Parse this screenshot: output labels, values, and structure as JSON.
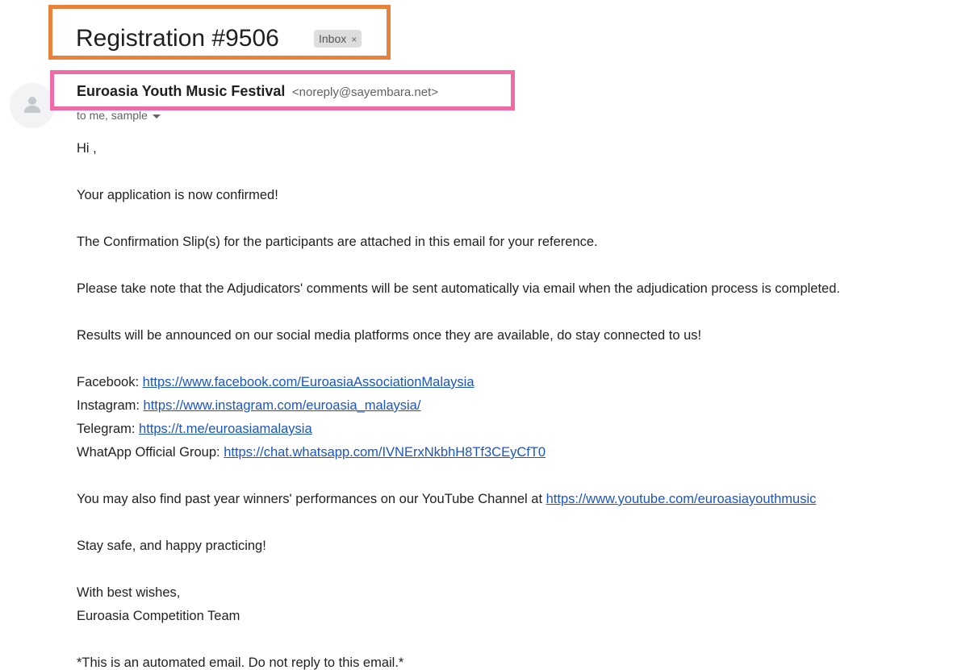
{
  "subject": {
    "title": "Registration #9506",
    "label": "Inbox",
    "label_close": "×"
  },
  "sender": {
    "name": "Euroasia Youth Music Festival",
    "email": "<noreply@sayembara.net>",
    "recipients": "to me, sample"
  },
  "body": {
    "greeting": "Hi ,",
    "confirmed": "Your application is now confirmed!",
    "slip": "The Confirmation Slip(s) for the participants are attached in this email for your reference.",
    "adjudicators": "Please take note that the Adjudicators' comments will be sent automatically via email when the adjudication process is completed.",
    "results": "Results will be announced on our social media platforms once they are available, do stay connected to us!",
    "links": [
      {
        "label": "Facebook: ",
        "url": "https://www.facebook.com/EuroasiaAssociationMalaysia"
      },
      {
        "label": "Instagram: ",
        "url": "https://www.instagram.com/euroasia_malaysia/"
      },
      {
        "label": "Telegram: ",
        "url": "https://t.me/euroasiamalaysia"
      },
      {
        "label": "WhatApp Official Group: ",
        "url": "https://chat.whatsapp.com/IVNErxNkbhH8Tf3CEyCfT0"
      }
    ],
    "youtube_text": "You may also find past year winners' performances on our YouTube Channel at ",
    "youtube_url": "https://www.youtube.com/euroasiayouthmusic",
    "closing": "Stay safe, and happy practicing!",
    "signoff": "With best wishes,",
    "team": "Euroasia Competition Team",
    "footer": "*This is an automated email. Do not reply to this email.*"
  },
  "colors": {
    "subject_highlight": "#e8823b",
    "sender_highlight": "#f06aa5",
    "link": "#1a55c4"
  },
  "icons": {
    "avatar": "person-icon",
    "chip_close": "close-icon",
    "recipients_toggle": "caret-down-icon"
  }
}
